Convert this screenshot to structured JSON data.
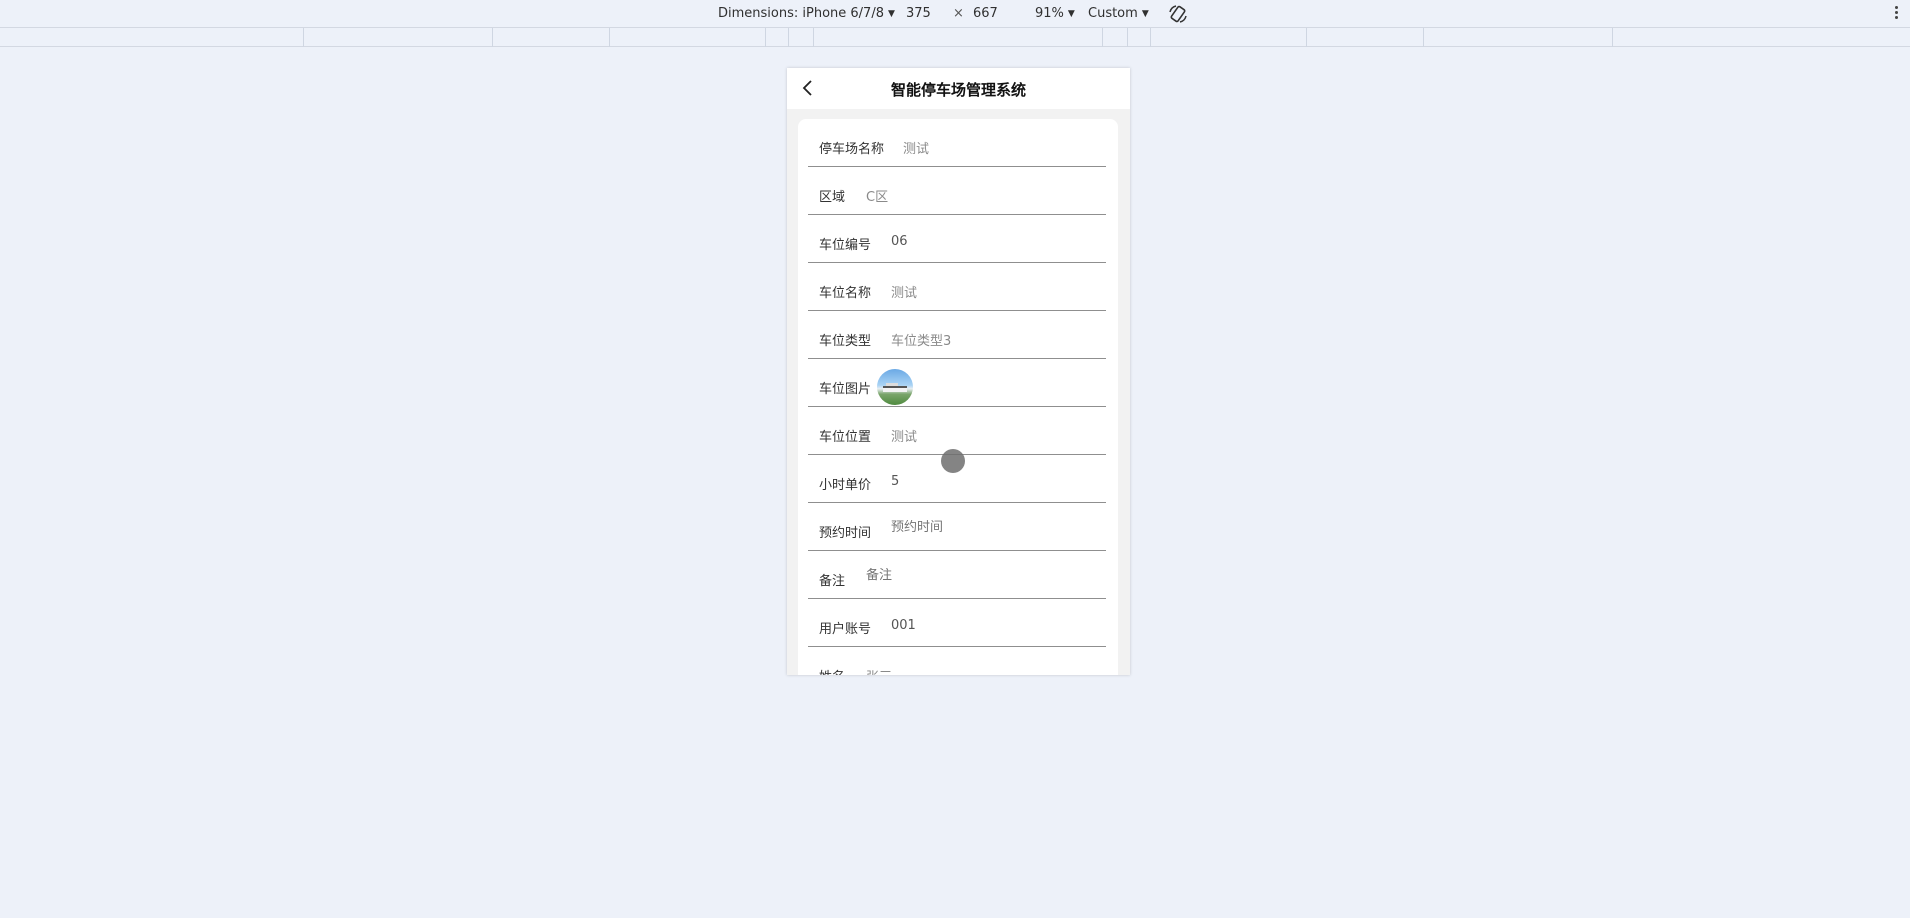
{
  "devtools": {
    "dimensions_label": "Dimensions: iPhone 6/7/8",
    "width": "375",
    "times": "×",
    "height": "667",
    "zoom": "91%",
    "throttle": "Custom"
  },
  "app": {
    "title": "智能停车场管理系统"
  },
  "form": {
    "fields": [
      {
        "label": "停车场名称",
        "value": "测试"
      },
      {
        "label": "区域",
        "value": "C区"
      },
      {
        "label": "车位编号",
        "value": "06"
      },
      {
        "label": "车位名称",
        "value": "测试"
      },
      {
        "label": "车位类型",
        "value": "车位类型3"
      },
      {
        "label": "车位图片",
        "value": ""
      },
      {
        "label": "车位位置",
        "value": "测试"
      },
      {
        "label": "小时单价",
        "value": "5"
      },
      {
        "label": "预约时间",
        "placeholder": "预约时间"
      },
      {
        "label": "备注",
        "placeholder": "备注"
      },
      {
        "label": "用户账号",
        "value": "001"
      },
      {
        "label": "姓名",
        "value": "张三"
      }
    ]
  },
  "colors": {
    "page_bg": "#edf1f9",
    "phone_bg": "#f2f2f2",
    "card_bg": "#ffffff",
    "divider": "#8f8f8f"
  }
}
